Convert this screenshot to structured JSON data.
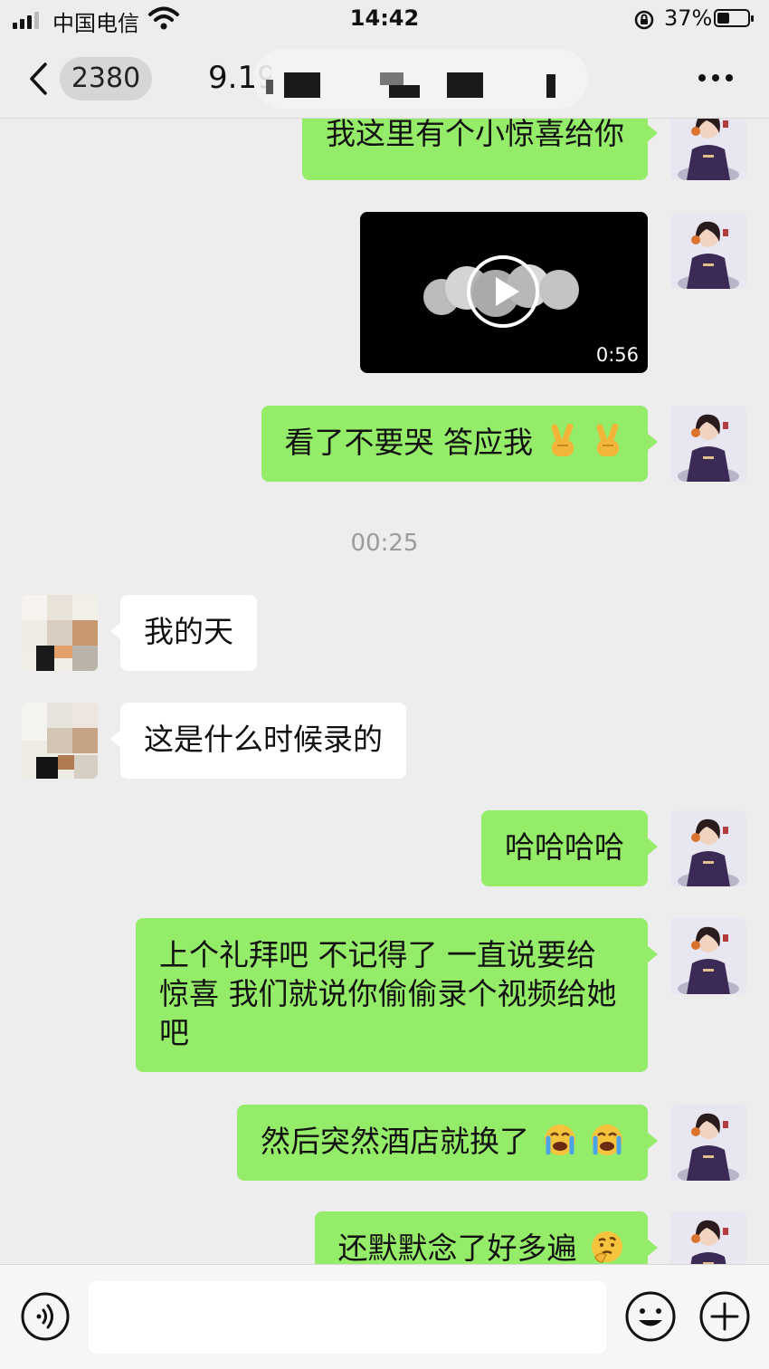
{
  "status_bar": {
    "carrier": "中国电信",
    "time": "14:42",
    "battery": "37%"
  },
  "nav": {
    "unread_count": "2380",
    "title_prefix": "9.19"
  },
  "messages": [
    {
      "id": "m1",
      "side": "out",
      "text": "我这里有个小惊喜给你"
    },
    {
      "id": "m2",
      "side": "out",
      "type": "video",
      "duration": "0:56"
    },
    {
      "id": "m3",
      "side": "out",
      "text": "看了不要哭 答应我",
      "emoji": [
        "victory-hand-icon",
        "victory-hand-icon"
      ]
    },
    {
      "id": "t1",
      "type": "timestamp",
      "text": "00:25"
    },
    {
      "id": "m4",
      "side": "in",
      "text": "我的天"
    },
    {
      "id": "m5",
      "side": "in",
      "text": "这是什么时候录的"
    },
    {
      "id": "m6",
      "side": "out",
      "text": "哈哈哈哈"
    },
    {
      "id": "m7",
      "side": "out",
      "text": "上个礼拜吧 不记得了 一直说要给惊喜 我们就说你偷偷录个视频给她吧"
    },
    {
      "id": "m8",
      "side": "out",
      "text": "然后突然酒店就换了",
      "emoji": [
        "loudly-crying-face-icon",
        "loudly-crying-face-icon"
      ]
    },
    {
      "id": "m9",
      "side": "out",
      "text": "还默默念了好多遍",
      "emoji": [
        "thinking-face-icon"
      ]
    }
  ],
  "input": {
    "placeholder": ""
  },
  "colors": {
    "outgoing_bubble": "#95ec69",
    "incoming_bubble": "#ffffff",
    "background": "#ededed"
  }
}
